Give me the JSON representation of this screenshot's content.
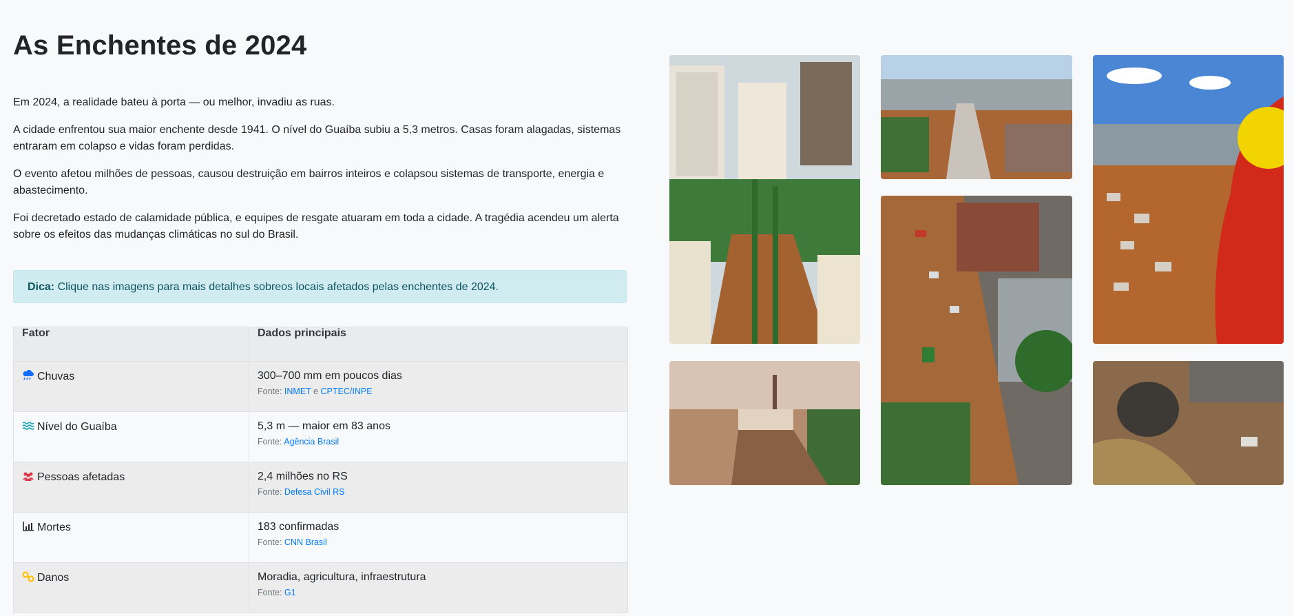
{
  "page": {
    "title": "As Enchentes de 2024",
    "paragraphs": [
      "Em 2024, a realidade bateu à porta — ou melhor, invadiu as ruas.",
      "A cidade enfrentou sua maior enchente desde 1941. O nível do Guaíba subiu a 5,3 metros. Casas foram alagadas, sistemas entraram em colapso e vidas foram perdidas.",
      "O evento afetou milhões de pessoas, causou destruição em bairros inteiros e colapsou sistemas de transporte, energia e abastecimento.",
      "Foi decretado estado de calamidade pública, e equipes de resgate atuaram em toda a cidade. A tragédia acendeu um alerta sobre os efeitos das mudanças climáticas no sul do Brasil."
    ],
    "tip": {
      "label": "Dica:",
      "text": " Clique nas imagens para mais detalhes sobreos locais afetados pelas enchentes de 2024."
    }
  },
  "table": {
    "headers": [
      "Fator",
      "Dados principais"
    ],
    "source_prefix": "Fonte:",
    "rows": [
      {
        "factor": "Chuvas",
        "icon": "rain-cloud-icon",
        "icon_color": "#0d6efd",
        "data": "300–700 mm em poucos dias",
        "sources": [
          "INMET",
          "CPTEC/INPE"
        ],
        "joiner": "e"
      },
      {
        "factor": "Nível do Guaíba",
        "icon": "water-waves-icon",
        "icon_color": "#17a2b8",
        "data": "5,3 m — maior em 83 anos",
        "sources": [
          "Agência Brasil"
        ]
      },
      {
        "factor": "Pessoas afetadas",
        "icon": "people-icon",
        "icon_color": "#dc3545",
        "data": "2,4 milhões no RS",
        "sources": [
          "Defesa Civil RS"
        ]
      },
      {
        "factor": "Mortes",
        "icon": "chart-icon",
        "icon_color": "#212529",
        "data": "183 confirmadas",
        "sources": [
          "CNN Brasil"
        ]
      },
      {
        "factor": "Danos",
        "icon": "tools-icon",
        "icon_color": "#ffc107",
        "data": "Moradia, agricultura, infraestrutura",
        "sources": [
          "G1"
        ]
      }
    ]
  },
  "gallery": [
    {
      "name": "flooded-plaza-aerial"
    },
    {
      "name": "flooded-avenue-aerial"
    },
    {
      "name": "rescuer-over-flooded-neighborhood"
    },
    {
      "name": "flooded-street-cars"
    },
    {
      "name": "flooded-waterfront-sunset"
    },
    {
      "name": "helicopter-rescue-boat"
    }
  ],
  "colors": {
    "tip_bg": "#d1ecf1",
    "tip_text": "#0c5460",
    "link": "#007bff",
    "flood_brown": "#a0522d"
  }
}
